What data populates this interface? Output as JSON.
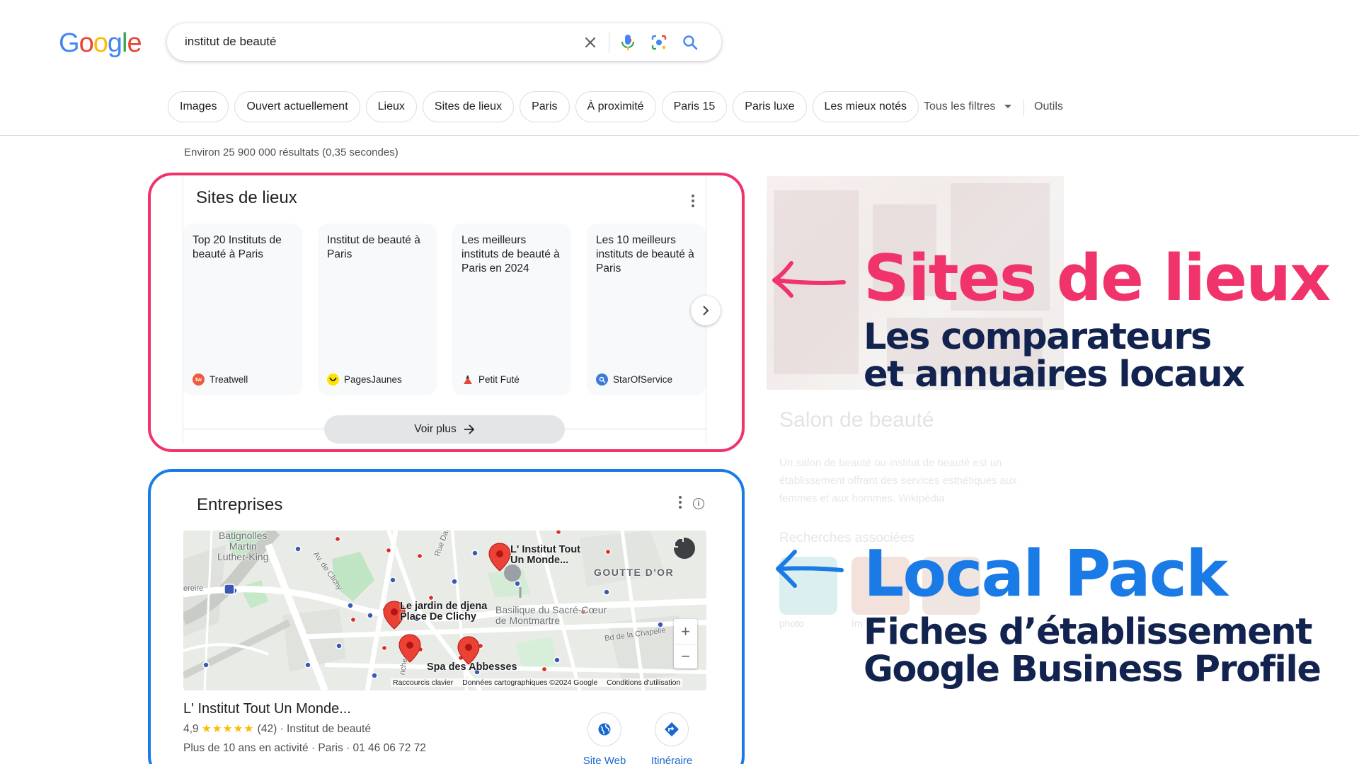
{
  "header": {
    "logo_letters": [
      "G",
      "o",
      "o",
      "g",
      "l",
      "e"
    ],
    "logo_colors": [
      "#4285f4",
      "#ea4335",
      "#fbbc05",
      "#4285f4",
      "#34a853",
      "#ea4335"
    ],
    "search_value": "institut de beauté",
    "icons": [
      "close-icon",
      "mic-icon",
      "lens-icon",
      "search-icon"
    ]
  },
  "chips": [
    "Images",
    "Ouvert actuellement",
    "Lieux",
    "Sites de lieux",
    "Paris",
    "À proximité",
    "Paris 15",
    "Paris luxe",
    "Les mieux notés"
  ],
  "tools": {
    "all_filters": "Tous les filtres",
    "tools": "Outils"
  },
  "results_stats": "Environ 25 900 000 résultats (0,35 secondes)",
  "sites_de_lieux": {
    "title": "Sites de lieux",
    "cards": [
      {
        "title": "Top 20 Instituts de beauté à Paris",
        "source": "Treatwell",
        "icon_color": "#ef5a3c",
        "icon_text": "tw"
      },
      {
        "title": "Institut de beauté à Paris",
        "source": "PagesJaunes",
        "icon_color": "#ffe400",
        "icon_text": ""
      },
      {
        "title": "Les meilleurs instituts de beauté à Paris en 2024",
        "source": "Petit Futé",
        "icon_color": "#e8453c",
        "icon_text": ""
      },
      {
        "title": "Les 10 meilleurs instituts de beauté à Paris",
        "source": "StarOfService",
        "icon_color": "#3d7bd9",
        "icon_text": ""
      }
    ],
    "more_label": "Voir plus"
  },
  "entreprises": {
    "title": "Entreprises",
    "map_labels": {
      "batignolles": "Batignolles\nMartin\nLuther-King",
      "institut": "L' Institut Tout\nUn Monde...",
      "goutte": "GOUTTE D'OR",
      "jardin": "Le jardin de djena\nPlace De Clichy",
      "basilique": "Basilique du Sacré-Cœur\nde Montmartre",
      "spa": "Spa des Abbesses",
      "avclichy": "Av. de Clichy",
      "ruedai": "Rue Dai",
      "chapelle": "Bd de la Chapelle",
      "ereire": "ereire",
      "nche": "nche"
    },
    "map_footer": [
      "Raccourcis clavier",
      "Données cartographiques ©2024 Google",
      "Conditions d'utilisation"
    ],
    "business": {
      "name": "L' Institut Tout Un Monde...",
      "rating": "4,9",
      "stars": "★★★★★",
      "reviews": "(42)",
      "category": "· Institut de beauté",
      "details": "Plus de 10 ans en activité · Paris · 01 46 06 72 72",
      "website_label": "Site Web",
      "directions_label": "Itinéraire"
    }
  },
  "knowledge_panel": {
    "title": "Salon de beauté",
    "description": "Un salon de beauté ou institut de beauté est un établissement offrant des services esthétiques aux femmes et aux hommes. Wikipédia",
    "related_title": "Recherches associées",
    "thumb_labels": [
      "photo",
      "Im"
    ]
  },
  "annotations": {
    "sites_title": "Sites de lieux",
    "sites_line1": "Les comparateurs",
    "sites_line2": "et annuaires locaux",
    "local_title": "Local Pack",
    "local_line1": "Fiches d’établissement",
    "local_line2": "Google Business Profile",
    "pink_color": "#f0336b",
    "blue_color": "#1a7be6",
    "navy_color": "#12234f"
  }
}
